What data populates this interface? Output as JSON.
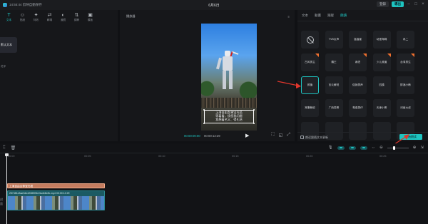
{
  "titlebar": {
    "left_text": "14:55:44 剪映自動保存",
    "project_title": "6月6日",
    "badge_lite": "登錄",
    "export_label": "導出"
  },
  "toolbar": {
    "items": [
      {
        "label": "文本",
        "icon": "T"
      },
      {
        "label": "貼紙",
        "icon": "☺"
      },
      {
        "label": "特效",
        "icon": "✦"
      },
      {
        "label": "轉場",
        "icon": "⇄"
      },
      {
        "label": "濾鏡",
        "icon": "◐"
      },
      {
        "label": "調節",
        "icon": "⇅"
      },
      {
        "label": "模板",
        "icon": "▣"
      }
    ]
  },
  "left_panel": {
    "card_label": "默认文本",
    "side_label": "花字"
  },
  "player": {
    "title": "播放器",
    "menu_icon": "≡",
    "caption_lines": [
      "上海自由女神宝光塔",
      "等着看，接您我问题",
      "我想着名义、得扎哈"
    ],
    "current_time": "00:00:00:00",
    "total_time": "00:00:12:29",
    "play_icon": "▶",
    "foot_icons": [
      "⛶",
      "◱",
      "⤢"
    ]
  },
  "right_panel": {
    "tabs": [
      "文本",
      "動畫",
      "跟蹤",
      "朗讀"
    ],
    "active_tab": 3,
    "cells": [
      {
        "label": "",
        "type": "none",
        "badge": false
      },
      {
        "label": "TVB女声",
        "badge": false
      },
      {
        "label": "温温星",
        "badge": false
      },
      {
        "label": "动漫海绵",
        "badge": false
      },
      {
        "label": "冉二",
        "badge": false
      },
      {
        "label": "古风男主",
        "badge": true
      },
      {
        "label": "霸王",
        "badge": false
      },
      {
        "label": "麻恣",
        "badge": true
      },
      {
        "label": "少儿频道",
        "badge": true
      },
      {
        "label": "台湾男生",
        "badge": true
      },
      {
        "label": "颜值",
        "badge": false,
        "selected": true
      },
      {
        "label": "言炎解说",
        "badge": false
      },
      {
        "label": "促销男声",
        "badge": false
      },
      {
        "label": "四姨",
        "badge": false
      },
      {
        "label": "醉酒小韩",
        "badge": false
      },
      {
        "label": "常事解说",
        "badge": false
      },
      {
        "label": "广西表哥",
        "badge": false
      },
      {
        "label": "粤语男仔",
        "badge": false
      },
      {
        "label": "天津小哥",
        "badge": false
      },
      {
        "label": "河南大叔",
        "badge": false
      },
      {
        "label": "",
        "badge": false
      },
      {
        "label": "",
        "badge": false
      },
      {
        "label": "",
        "badge": false
      },
      {
        "label": "",
        "badge": false
      },
      {
        "label": "",
        "badge": false
      }
    ],
    "checkbox_label": "朗读跟随文本更新",
    "start_button": "开始朗读"
  },
  "timeline": {
    "ruler_ticks": [
      "00:00",
      "00:05",
      "00:10",
      "00:15",
      "00:20",
      "00:25"
    ],
    "text_clip_label": "上海自由女神宝光塔",
    "video_clip_name": "257481e5ae34e4208f09b13cd46b2b.mp4",
    "video_clip_duration": "00:00:12:29",
    "side_label": "封面"
  },
  "colors": {
    "accent": "#1ec4c0",
    "background": "#101114",
    "panel": "#16171a",
    "text_clip": "#c47c5f",
    "video_clip": "#1b5a63",
    "annotation_arrow": "#e0362c"
  }
}
